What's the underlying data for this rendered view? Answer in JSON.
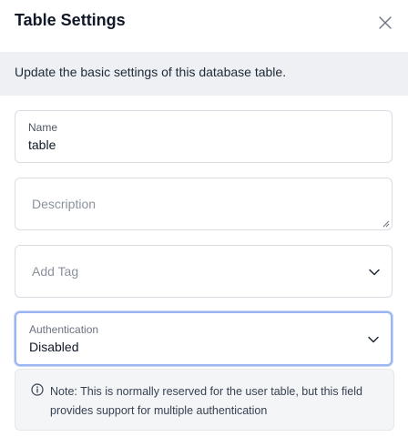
{
  "dialog": {
    "title": "Table Settings",
    "description": "Update the basic settings of this database table."
  },
  "fields": {
    "name": {
      "label": "Name",
      "value": "table"
    },
    "description": {
      "placeholder": "Description"
    },
    "tag": {
      "placeholder": "Add Tag"
    },
    "authentication": {
      "label": "Authentication",
      "value": "Disabled"
    }
  },
  "note": {
    "text": "Note: This is normally reserved for the user table, but this field provides support for multiple authentication"
  },
  "colors": {
    "focus_border": "#9bb5f2",
    "banner_bg": "#eef0f3",
    "note_bg": "#f3f5f7"
  },
  "icons": [
    "close-icon",
    "chevron-down-icon",
    "info-icon"
  ]
}
